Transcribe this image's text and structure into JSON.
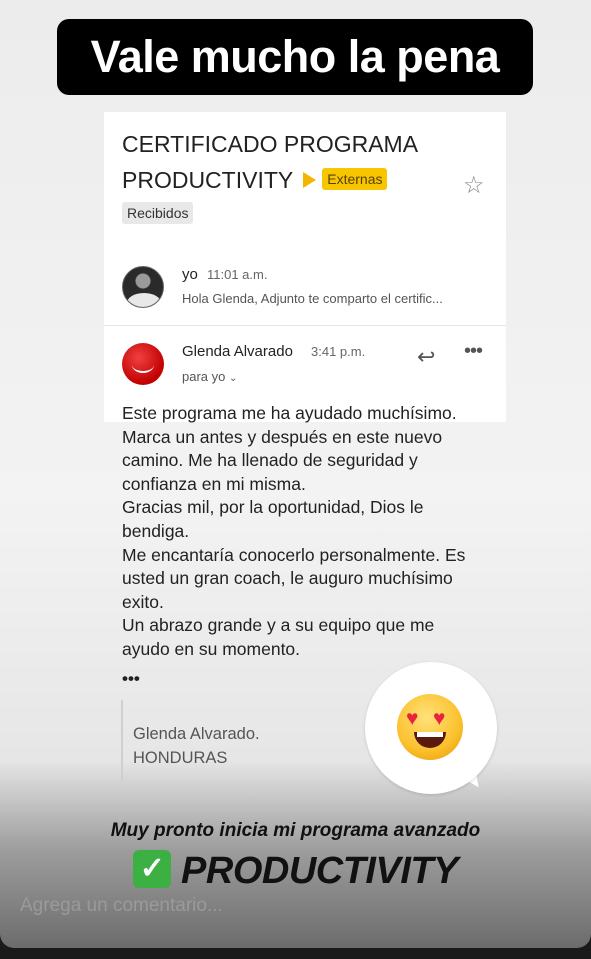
{
  "headline": "Vale mucho la pena",
  "email": {
    "subject_line1": "CERTIFICADO PROGRAMA",
    "subject_line2": "PRODUCTIVITY",
    "label_tag": "Externas",
    "inbox_chip": "Recibidos",
    "messages": [
      {
        "sender": "yo",
        "time": "11:01 a.m.",
        "snippet": "Hola Glenda, Adjunto te comparto el certific..."
      },
      {
        "sender": "Glenda Alvarado",
        "time": "3:41 p.m.",
        "recipient": "para yo"
      }
    ],
    "body": [
      "Este programa me ha ayudado muchísimo.",
      "Marca un antes y después en este nuevo",
      "camino. Me ha llenado de seguridad y",
      "confianza en mi misma.",
      "Gracias mil, por la oportunidad, Dios le",
      "bendiga.",
      "Me encantaría conocerlo personalmente. Es",
      "usted un gran coach, le auguro muchísimo",
      "exito.",
      "Un abrazo grande y a su equipo que me",
      "ayudo en su momento."
    ],
    "ellipsis": "•••",
    "signature": [
      "Glenda Alvarado.",
      "HONDURAS"
    ]
  },
  "promo": {
    "line1": "Muy pronto inicia mi programa avanzado",
    "check": "✓",
    "line2": "PRODUCTIVITY"
  },
  "comment_placeholder": "Agrega un comentario...",
  "icons": {
    "star": "star-icon",
    "reply": "reply-icon",
    "more": "more-options-icon",
    "chevron": "chevron-down-icon",
    "emoji": "heart-eyes-emoji-icon"
  }
}
